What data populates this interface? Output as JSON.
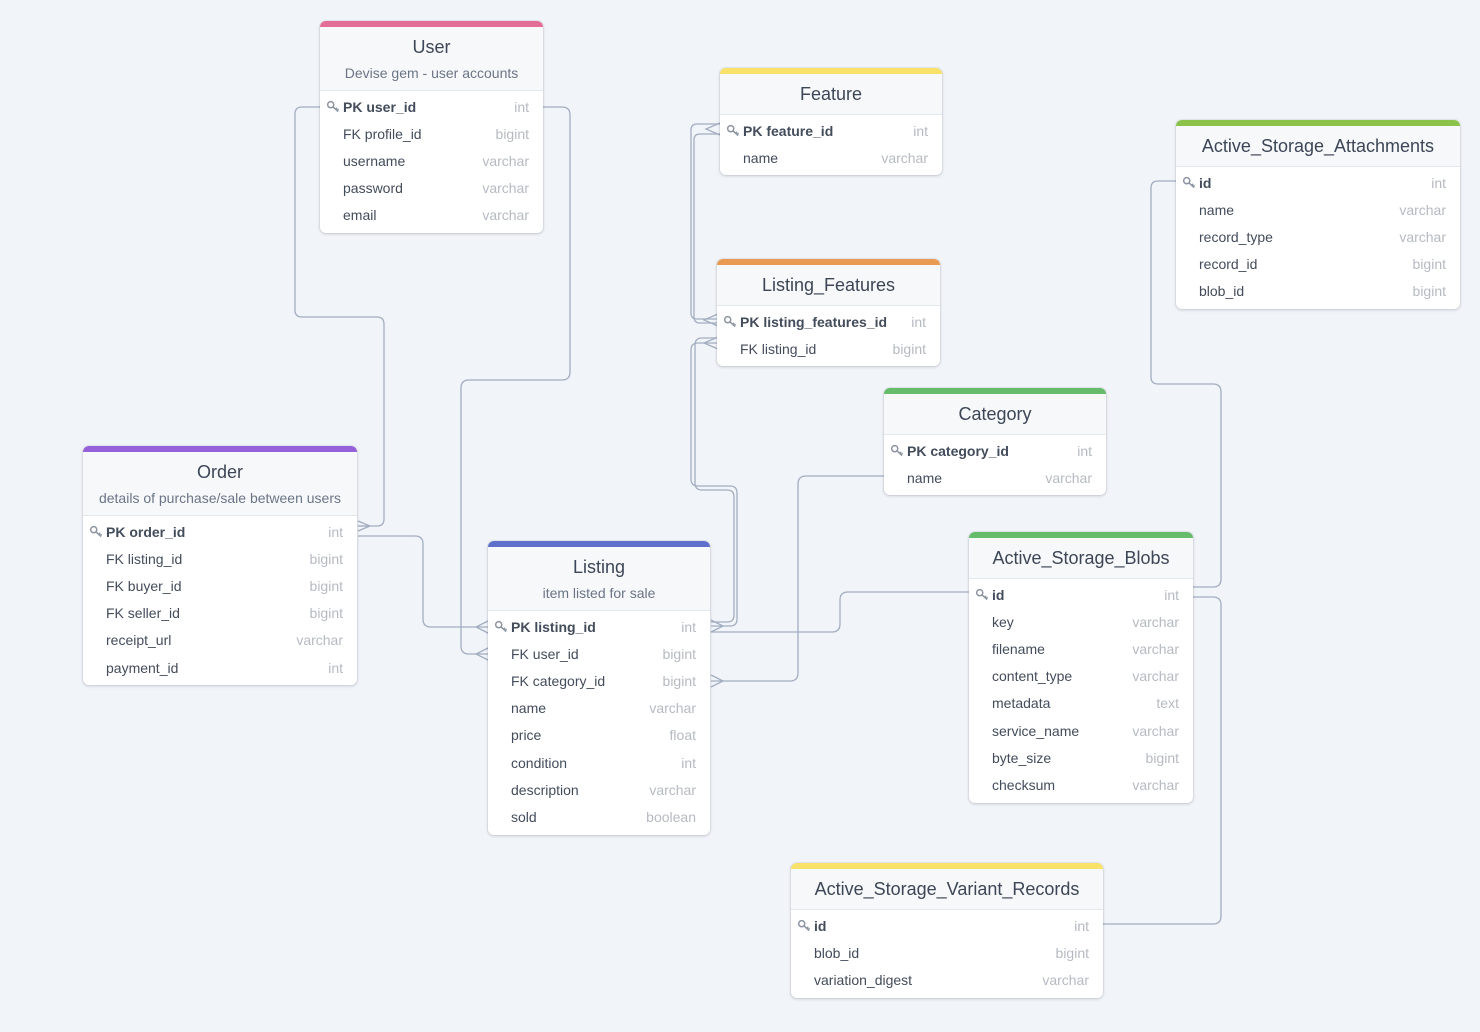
{
  "diagram": {
    "tables": [
      {
        "id": "user",
        "title": "User",
        "note": "Devise gem - user accounts",
        "color": "#e46d96",
        "columns": [
          {
            "name": "PK user_id",
            "type": "int",
            "pk": true
          },
          {
            "name": "FK profile_id",
            "type": "bigint"
          },
          {
            "name": "username",
            "type": "varchar"
          },
          {
            "name": "password",
            "type": "varchar"
          },
          {
            "name": "email",
            "type": "varchar"
          }
        ]
      },
      {
        "id": "feature",
        "title": "Feature",
        "note": "",
        "color": "#f8e26a",
        "columns": [
          {
            "name": "PK feature_id",
            "type": "int",
            "pk": true
          },
          {
            "name": "name",
            "type": "varchar"
          }
        ]
      },
      {
        "id": "listing_features",
        "title": "Listing_Features",
        "note": "",
        "color": "#e99a53",
        "columns": [
          {
            "name": "PK listing_features_id",
            "type": "int",
            "pk": true
          },
          {
            "name": "FK listing_id",
            "type": "bigint"
          }
        ]
      },
      {
        "id": "active_storage_attachments",
        "title": "Active_Storage_Attachments",
        "note": "",
        "color": "#8bc34a",
        "columns": [
          {
            "name": "id",
            "type": "int",
            "pk": true
          },
          {
            "name": "name",
            "type": "varchar"
          },
          {
            "name": "record_type",
            "type": "varchar"
          },
          {
            "name": "record_id",
            "type": "bigint"
          },
          {
            "name": "blob_id",
            "type": "bigint"
          }
        ]
      },
      {
        "id": "category",
        "title": "Category",
        "note": "",
        "color": "#66bb6a",
        "columns": [
          {
            "name": "PK category_id",
            "type": "int",
            "pk": true
          },
          {
            "name": "name",
            "type": "varchar"
          }
        ]
      },
      {
        "id": "order",
        "title": "Order",
        "note": "details of purchase/sale between users",
        "color": "#9461d9",
        "columns": [
          {
            "name": "PK order_id",
            "type": "int",
            "pk": true
          },
          {
            "name": "FK listing_id",
            "type": "bigint"
          },
          {
            "name": "FK buyer_id",
            "type": "bigint"
          },
          {
            "name": "FK seller_id",
            "type": "bigint"
          },
          {
            "name": "receipt_url",
            "type": "varchar"
          },
          {
            "name": "payment_id",
            "type": "int"
          }
        ]
      },
      {
        "id": "listing",
        "title": "Listing",
        "note": "item listed for sale",
        "color": "#5f6fcc",
        "columns": [
          {
            "name": "PK listing_id",
            "type": "int",
            "pk": true
          },
          {
            "name": "FK user_id",
            "type": "bigint"
          },
          {
            "name": "FK category_id",
            "type": "bigint"
          },
          {
            "name": "name",
            "type": "varchar"
          },
          {
            "name": "price",
            "type": "float"
          },
          {
            "name": "condition",
            "type": "int"
          },
          {
            "name": "description",
            "type": "varchar"
          },
          {
            "name": "sold",
            "type": "boolean"
          }
        ]
      },
      {
        "id": "active_storage_blobs",
        "title": "Active_Storage_Blobs",
        "note": "",
        "color": "#66bb6a",
        "columns": [
          {
            "name": "id",
            "type": "int",
            "pk": true
          },
          {
            "name": "key",
            "type": "varchar"
          },
          {
            "name": "filename",
            "type": "varchar"
          },
          {
            "name": "content_type",
            "type": "varchar"
          },
          {
            "name": "metadata",
            "type": "text"
          },
          {
            "name": "service_name",
            "type": "varchar"
          },
          {
            "name": "byte_size",
            "type": "bigint"
          },
          {
            "name": "checksum",
            "type": "varchar"
          }
        ]
      },
      {
        "id": "active_storage_variant_records",
        "title": "Active_Storage_Variant_Records",
        "note": "",
        "color": "#f8e26a",
        "columns": [
          {
            "name": "id",
            "type": "int",
            "pk": true
          },
          {
            "name": "blob_id",
            "type": "bigint"
          },
          {
            "name": "variation_digest",
            "type": "varchar"
          }
        ]
      }
    ],
    "relationships": [
      {
        "from": "User.user_id",
        "to": "Order.order_id",
        "cardinality": "one-to-many"
      },
      {
        "from": "User.user_id",
        "to": "Listing.FK user_id",
        "cardinality": "one-to-many"
      },
      {
        "from": "Order.order_id",
        "to": "Listing.listing_id",
        "cardinality": "one-to-many"
      },
      {
        "from": "Feature.feature_id",
        "to": "Listing_Features.listing_features_id",
        "cardinality": "one-to-many"
      },
      {
        "from": "Listing_Features.listing_id",
        "to": "Listing.listing_id",
        "cardinality": "many-to-many"
      },
      {
        "from": "Category.category_id",
        "to": "Listing.category_id",
        "cardinality": "one-to-many"
      },
      {
        "from": "Active_Storage_Blobs.id",
        "to": "Listing.listing_id",
        "cardinality": "one-to-many"
      },
      {
        "from": "Active_Storage_Attachments.id",
        "to": "Active_Storage_Blobs.id",
        "cardinality": "one-to-one"
      },
      {
        "from": "Active_Storage_Blobs.id",
        "to": "Active_Storage_Variant_Records.id",
        "cardinality": "one-to-one"
      }
    ]
  }
}
